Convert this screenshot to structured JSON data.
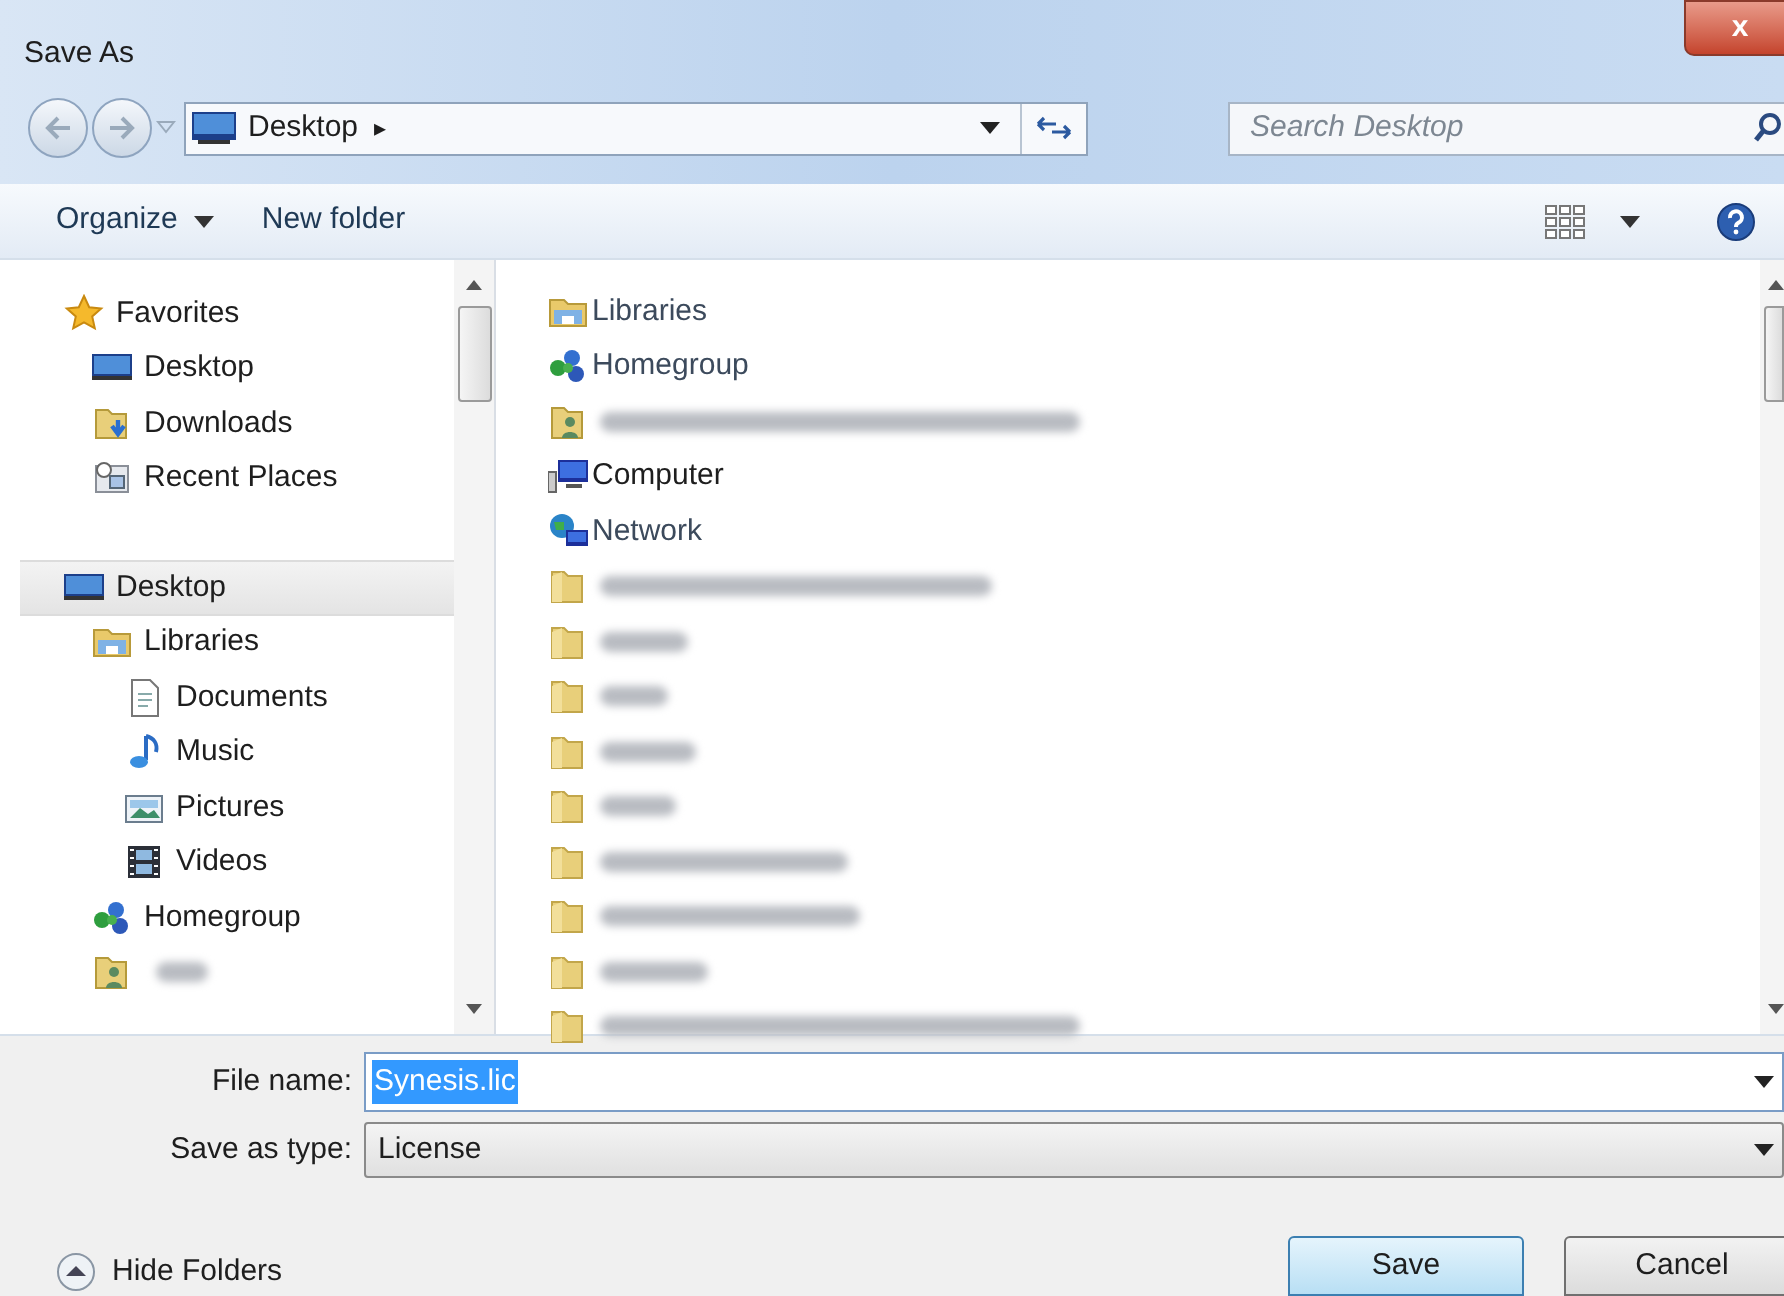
{
  "window": {
    "title": "Save As",
    "close": "x"
  },
  "address_bar": {
    "location": "Desktop",
    "separator": "▸",
    "search_placeholder": "Search Desktop"
  },
  "toolbar": {
    "items": [
      {
        "label": "Organize",
        "dropdown": true
      },
      {
        "label": "New folder",
        "dropdown": false
      }
    ]
  },
  "sidebar": {
    "items": [
      {
        "label": "Favorites",
        "kind": "star",
        "selected": false,
        "children": [
          {
            "label": "Desktop",
            "kind": "desktop",
            "selected": false
          },
          {
            "label": "Downloads",
            "kind": "downloads",
            "selected": false
          },
          {
            "label": "Recent Places",
            "kind": "recent",
            "selected": false
          }
        ]
      },
      {
        "label": "Desktop",
        "kind": "desktop",
        "selected": true,
        "children": [
          {
            "label": "Libraries",
            "kind": "libraries",
            "selected": false,
            "children": [
              {
                "label": "Documents",
                "kind": "documents",
                "selected": false
              },
              {
                "label": "Music",
                "kind": "music",
                "selected": false
              },
              {
                "label": "Pictures",
                "kind": "pictures",
                "selected": false
              },
              {
                "label": "Videos",
                "kind": "videos",
                "selected": false
              }
            ]
          },
          {
            "label": "Homegroup",
            "kind": "homegroup",
            "selected": false
          },
          {
            "kind": "user",
            "selected": false
          }
        ]
      }
    ]
  },
  "files": [
    {
      "label": "Libraries",
      "kind": "libraries"
    },
    {
      "label": "Homegroup",
      "kind": "homegroup"
    },
    {
      "kind": "user"
    },
    {
      "label": "Computer",
      "kind": "computer"
    },
    {
      "label": "Network",
      "kind": "network"
    },
    {
      "kind": "folder"
    },
    {
      "kind": "folder"
    },
    {
      "kind": "folder"
    },
    {
      "kind": "folder"
    },
    {
      "kind": "folder"
    },
    {
      "kind": "folder"
    },
    {
      "kind": "folder"
    },
    {
      "kind": "folder"
    },
    {
      "kind": "folder"
    }
  ],
  "form": {
    "file_name_label": "File name:",
    "file_name": "Synesis.lic",
    "type_label": "Save as type:",
    "type": "License"
  },
  "footer": {
    "hide_folders": "Hide Folders",
    "buttons": [
      {
        "label": "Save",
        "default": true
      },
      {
        "label": "Cancel",
        "default": false
      }
    ]
  }
}
